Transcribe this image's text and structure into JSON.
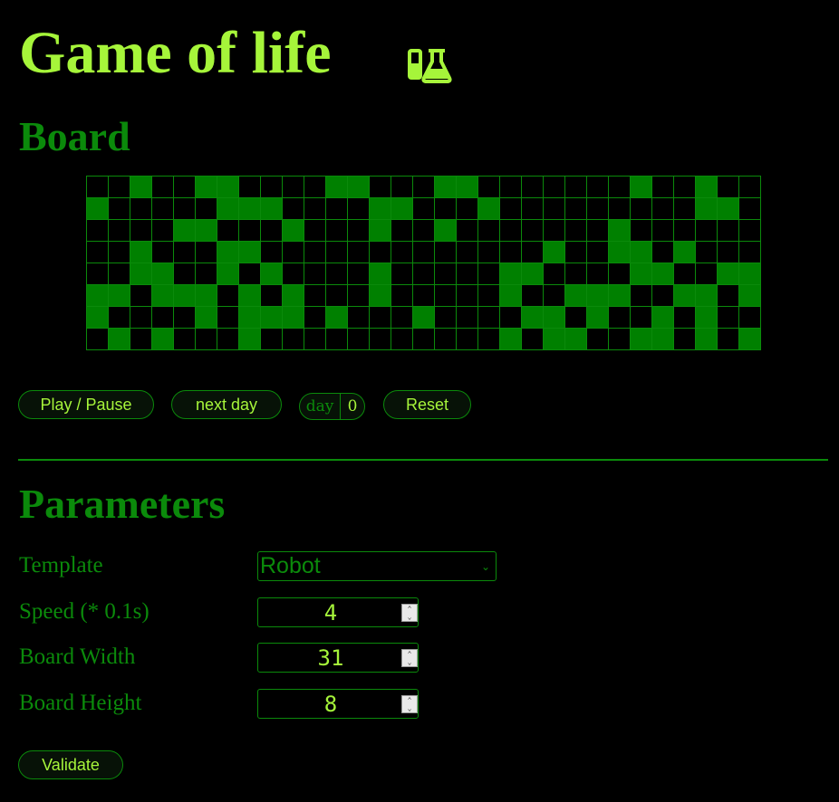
{
  "header": {
    "title": "Game of life",
    "icon": "flask-icon"
  },
  "board_section": {
    "title": "Board"
  },
  "board": {
    "width": 31,
    "height": 8,
    "rows": [
      "0010011000011000110000000100100",
      "1000001110000110001000000000110",
      "0000110001000100100000001000000",
      "0010001100000000000001001101000",
      "0011001010000100000110000110011",
      "1101110101000100000100111001101",
      "1000010111010001000011010010100",
      "0101000100000000000101100110101"
    ]
  },
  "controls": {
    "play_pause": "Play / Pause",
    "next_day": "next day",
    "day_label": "day",
    "day_value": "0",
    "reset": "Reset"
  },
  "parameters": {
    "title": "Parameters",
    "template_label": "Template",
    "template_value": "Robot",
    "speed_label": "Speed (* 0.1s)",
    "speed_value": "4",
    "width_label": "Board Width",
    "width_value": "31",
    "height_label": "Board Height",
    "height_value": "8",
    "validate": "Validate"
  },
  "colors": {
    "accent": "#a6f53a",
    "primary": "#0b8a0b",
    "cell_alive": "#008000",
    "background": "#000000"
  }
}
